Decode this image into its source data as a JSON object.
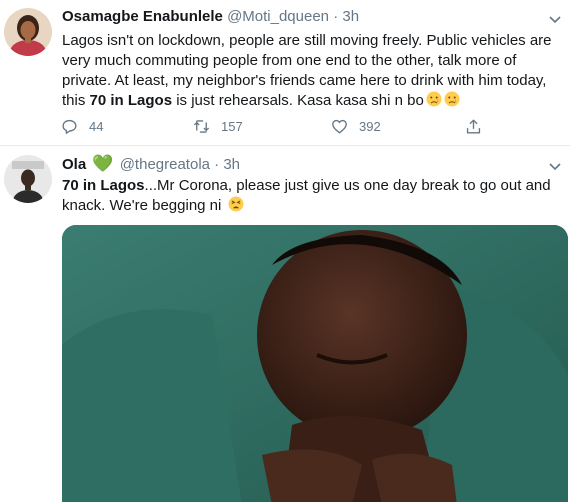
{
  "tweets": [
    {
      "author": {
        "name": "Osamagbe Enabunlele",
        "handle": "@Moti_dqueen",
        "time": "3h",
        "avatar_icon": "woman-portrait"
      },
      "text": {
        "intro": "Lagos isn't on lockdown, people are still moving freely. Public vehicles are very much commuting people from one end to the other, talk more of private. At least, my neighbor's friends came here to drink with him today, this ",
        "keyword": "70 in Lagos",
        "outro": " is just rehearsals. Kasa kasa shi n bo",
        "emojis": [
          "crying-face",
          "crying-face"
        ]
      },
      "actions": {
        "replies": "44",
        "retweets": "157",
        "likes": "392"
      }
    },
    {
      "author": {
        "name": "Ola",
        "heart": "💚",
        "handle": "@thegreatola",
        "time": "3h",
        "avatar_icon": "man-portrait"
      },
      "text": {
        "keyword": "70 in Lagos",
        "outro": "...Mr Corona, please just give us one day break to go out and knack. We're begging ni",
        "emojis": [
          "tired-face"
        ]
      },
      "media": {
        "icon": "photo-man-crying"
      }
    }
  ],
  "colors": {
    "secondary_text": "#657786",
    "divider": "#e6ecf0",
    "heart": "#77b255",
    "emoji_yellow": "#ffcc4d"
  }
}
